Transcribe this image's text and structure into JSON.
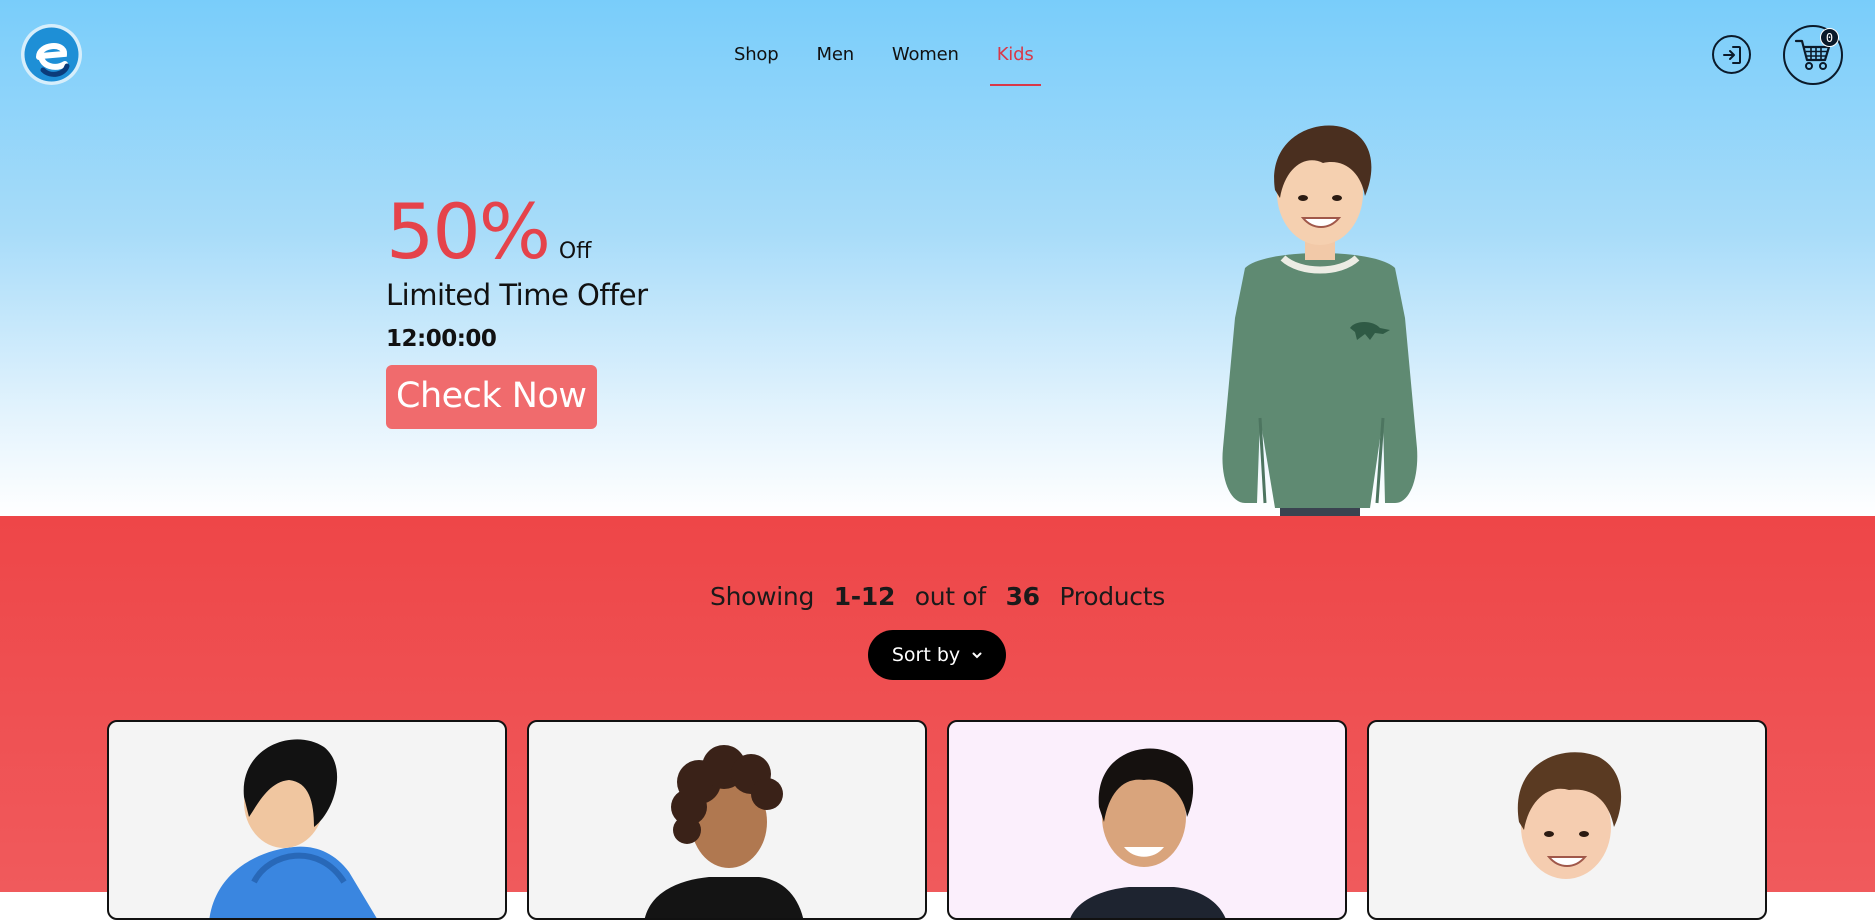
{
  "header": {
    "logo_icon": "e-logo-icon",
    "nav": [
      {
        "label": "Shop",
        "active": false
      },
      {
        "label": "Men",
        "active": false
      },
      {
        "label": "Women",
        "active": false
      },
      {
        "label": "Kids",
        "active": true
      }
    ],
    "login_icon": "login-arrow-icon",
    "cart_icon": "cart-icon",
    "cart_count": "0"
  },
  "hero": {
    "discount": "50%",
    "discount_suffix": "Off",
    "offer_text": "Limited Time Offer",
    "timer": "12:00:00",
    "cta_label": "Check Now"
  },
  "products": {
    "showing_prefix": "Showing",
    "range": "1-12",
    "out_of": "out of",
    "total": "36",
    "suffix": "Products",
    "sort_label": "Sort by",
    "sort_icon": "chevron-down-icon"
  },
  "colors": {
    "accent_red": "#e5434b",
    "nav_active": "#d93848",
    "cta_bg": "#f06b6d",
    "section_bg": "#ee4648",
    "hero_sky": "#79cdfa"
  }
}
